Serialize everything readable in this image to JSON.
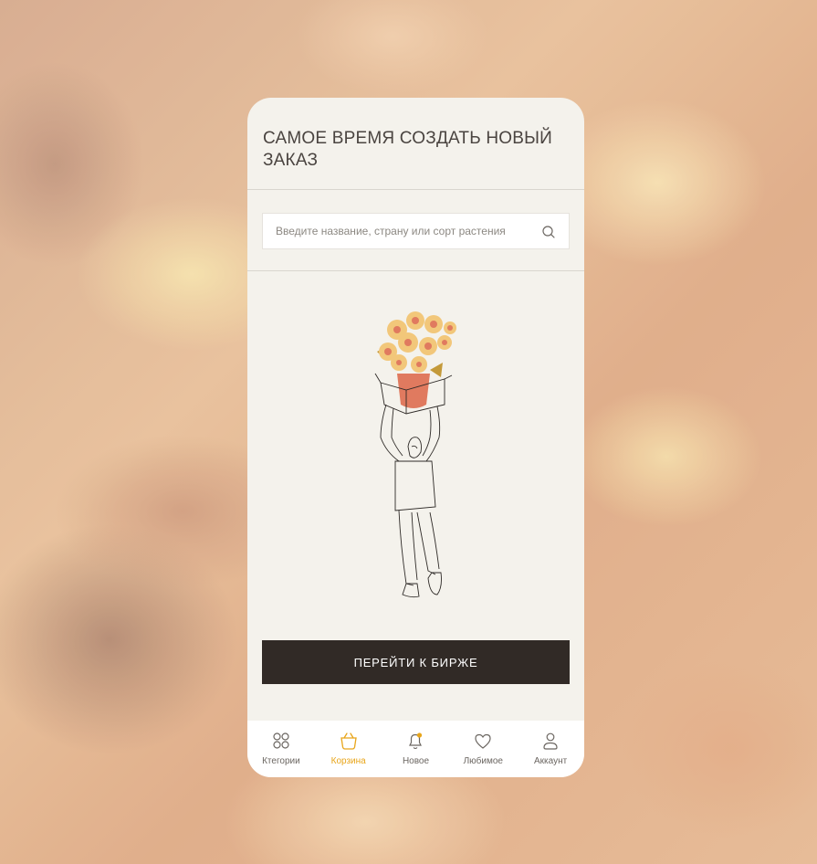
{
  "header": {
    "title": "САМОЕ ВРЕМЯ СОЗДАТЬ НОВЫЙ ЗАКАЗ"
  },
  "search": {
    "placeholder": "Введите название, страну или сорт растения",
    "icon": "search-icon"
  },
  "cta": {
    "label": "ПЕРЕЙТИ К БИРЖЕ"
  },
  "tabbar": {
    "active": "Корзина",
    "items": [
      {
        "label": "Ктегории",
        "icon": "grid-icon"
      },
      {
        "label": "Корзина",
        "icon": "basket-icon"
      },
      {
        "label": "Новое",
        "icon": "bell-icon"
      },
      {
        "label": "Любимое",
        "icon": "heart-icon"
      },
      {
        "label": "Аккаунт",
        "icon": "user-icon"
      }
    ]
  },
  "colors": {
    "accent": "#e8a51a",
    "button": "#312a26",
    "surface": "#f4f2ec",
    "text": "#4a4440",
    "vase": "#e07a5f",
    "flower": "#f2c77a"
  }
}
